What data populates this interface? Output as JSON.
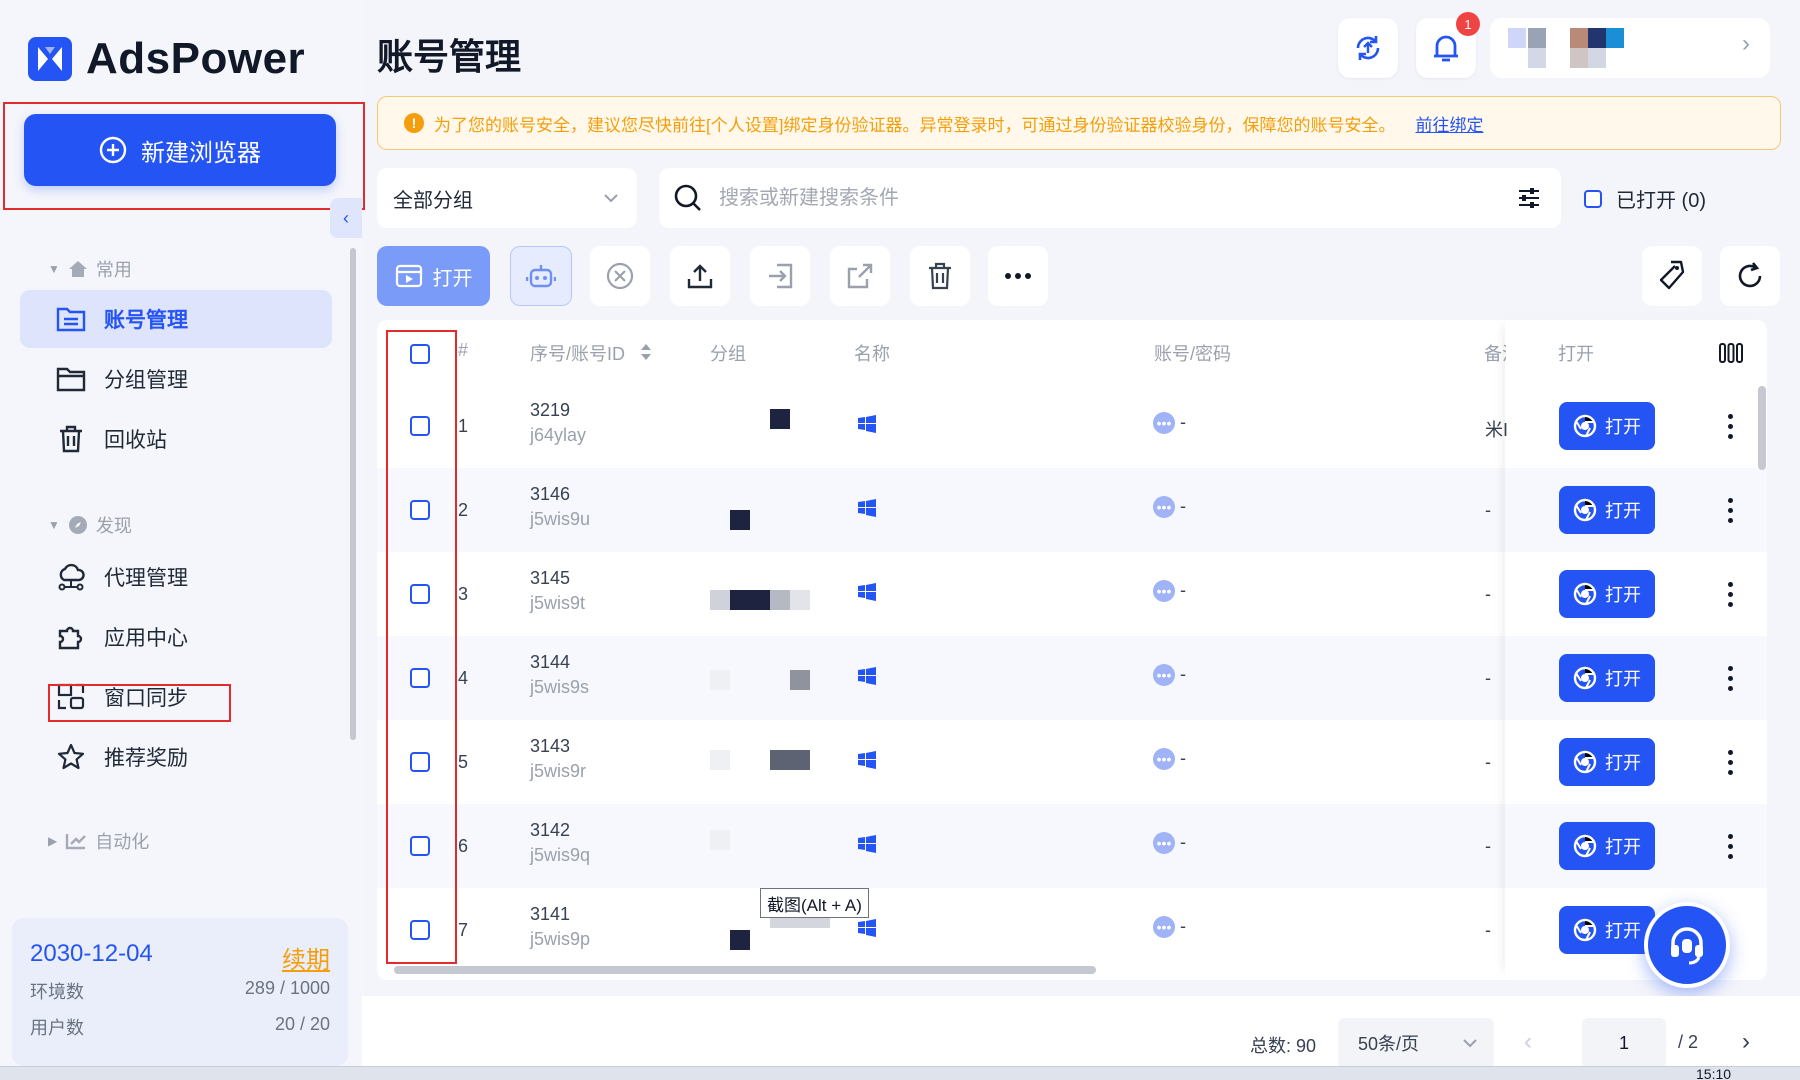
{
  "app": {
    "name": "AdsPower"
  },
  "sidebar": {
    "new_browser_label": "新建浏览器",
    "sections": [
      {
        "label": "常用",
        "items": [
          "账号管理",
          "分组管理",
          "回收站"
        ]
      },
      {
        "label": "发现",
        "items": [
          "代理管理",
          "应用中心",
          "窗口同步",
          "推荐奖励"
        ]
      },
      {
        "label": "自动化",
        "items": []
      }
    ],
    "subscription": {
      "expiry": "2030-12-04",
      "renew_label": "续期",
      "env_label": "环境数",
      "env_value": "289 / 1000",
      "user_label": "用户数",
      "user_value": "20 / 20"
    }
  },
  "header": {
    "title": "账号管理",
    "notification_count": "1"
  },
  "alert": {
    "text": "为了您的账号安全，建议您尽快前往[个人设置]绑定身份验证器。异常登录时，可通过身份验证器校验身份，保障您的账号安全。",
    "link": "前往绑定"
  },
  "filters": {
    "group_select": "全部分组",
    "search_placeholder": "搜索或新建搜索条件",
    "opened_label": "已打开 (0)"
  },
  "toolbar": {
    "open_label": "打开"
  },
  "table": {
    "columns": {
      "index": "#",
      "serial": "序号/账号ID",
      "group": "分组",
      "name": "名称",
      "account": "账号/密码",
      "remark": "备注",
      "open": "打开"
    },
    "rows": [
      {
        "index": "1",
        "serial": "3219",
        "id": "j64ylay",
        "account": "-",
        "remark": "米I",
        "open_label": "打开"
      },
      {
        "index": "2",
        "serial": "3146",
        "id": "j5wis9u",
        "account": "-",
        "remark": "-",
        "open_label": "打开"
      },
      {
        "index": "3",
        "serial": "3145",
        "id": "j5wis9t",
        "account": "-",
        "remark": "-",
        "open_label": "打开"
      },
      {
        "index": "4",
        "serial": "3144",
        "id": "j5wis9s",
        "account": "-",
        "remark": "-",
        "open_label": "打开"
      },
      {
        "index": "5",
        "serial": "3143",
        "id": "j5wis9r",
        "account": "-",
        "remark": "-",
        "open_label": "打开"
      },
      {
        "index": "6",
        "serial": "3142",
        "id": "j5wis9q",
        "account": "-",
        "remark": "-",
        "open_label": "打开"
      },
      {
        "index": "7",
        "serial": "3141",
        "id": "j5wis9p",
        "account": "-",
        "remark": "-",
        "open_label": "打开"
      }
    ]
  },
  "tooltip": "截图(Alt + A)",
  "pagination": {
    "total": "总数: 90",
    "page_size": "50条/页",
    "current": "1",
    "total_pages": "/ 2"
  },
  "taskbar": {
    "clock": "15:10"
  },
  "colors": {
    "primary": "#2554f5",
    "warning": "#f59e0b",
    "annotation": "#e32b2b"
  }
}
